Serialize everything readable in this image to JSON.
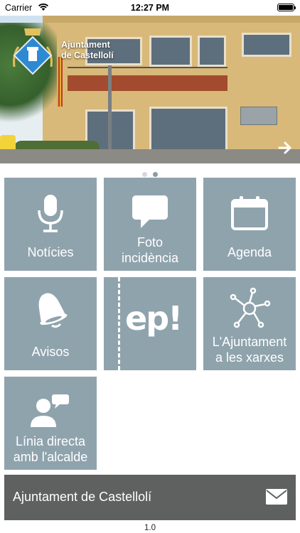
{
  "status_bar": {
    "carrier": "Carrier",
    "time": "12:27 PM",
    "battery_level_percent": 100
  },
  "hero": {
    "title_line1": "Ajuntament",
    "title_line2": "de Castellolí",
    "next_icon": "arrow-right-icon",
    "page_indicator": {
      "pages": 2,
      "active_index": 1
    }
  },
  "tiles": [
    {
      "line1": "Notícies",
      "line2": "",
      "icon": "microphone-icon"
    },
    {
      "line1": "Foto",
      "line2": "incidència",
      "icon": "speech-bubble-icon"
    },
    {
      "line1": "Agenda",
      "line2": "",
      "icon": "calendar-icon"
    },
    {
      "line1": "Avisos",
      "line2": "",
      "icon": "bell-icon"
    },
    {
      "line1": "ep!",
      "line2": "",
      "icon": "ep-logo"
    },
    {
      "line1": "L'Ajuntament",
      "line2": "a les xarxes",
      "icon": "network-icon"
    },
    {
      "line1": "Línia directa",
      "line2": "amb l'alcalde",
      "icon": "person-chat-icon"
    }
  ],
  "footer": {
    "label": "Ajuntament de Castellolí",
    "icon": "mail-icon"
  },
  "version": "1.0",
  "colors": {
    "tile_background": "#8fa3ad",
    "footer_background": "#5f6161",
    "text_on_tile": "#ffffff"
  }
}
